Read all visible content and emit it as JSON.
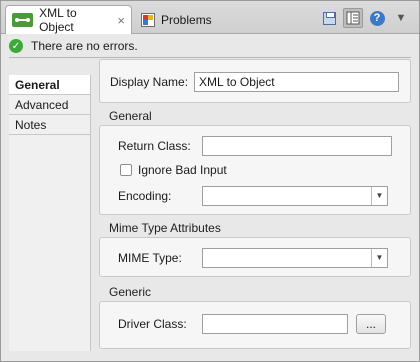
{
  "tabs": [
    {
      "label": "XML to Object",
      "close": "×"
    },
    {
      "label": "Problems"
    }
  ],
  "toolbar": {
    "save_icon": "save-icon",
    "layout_icon": "layout-icon",
    "help_icon_glyph": "?",
    "menu_glyph": "▼"
  },
  "status": {
    "icon_glyph": "✓",
    "text": "There are no errors."
  },
  "nav": {
    "items": [
      {
        "label": "General"
      },
      {
        "label": "Advanced"
      },
      {
        "label": "Notes"
      }
    ]
  },
  "form": {
    "display_name_label": "Display Name:",
    "display_name_value": "XML to Object",
    "general": {
      "title": "General",
      "return_class_label": "Return Class:",
      "return_class_value": "",
      "ignore_bad_input_label": "Ignore Bad Input",
      "encoding_label": "Encoding:",
      "encoding_value": ""
    },
    "mime": {
      "title": "Mime Type Attributes",
      "mime_type_label": "MIME Type:",
      "mime_type_value": ""
    },
    "generic": {
      "title": "Generic",
      "driver_class_label": "Driver Class:",
      "driver_class_value": "",
      "browse_label": "..."
    }
  },
  "select_arrow_glyph": "▼"
}
